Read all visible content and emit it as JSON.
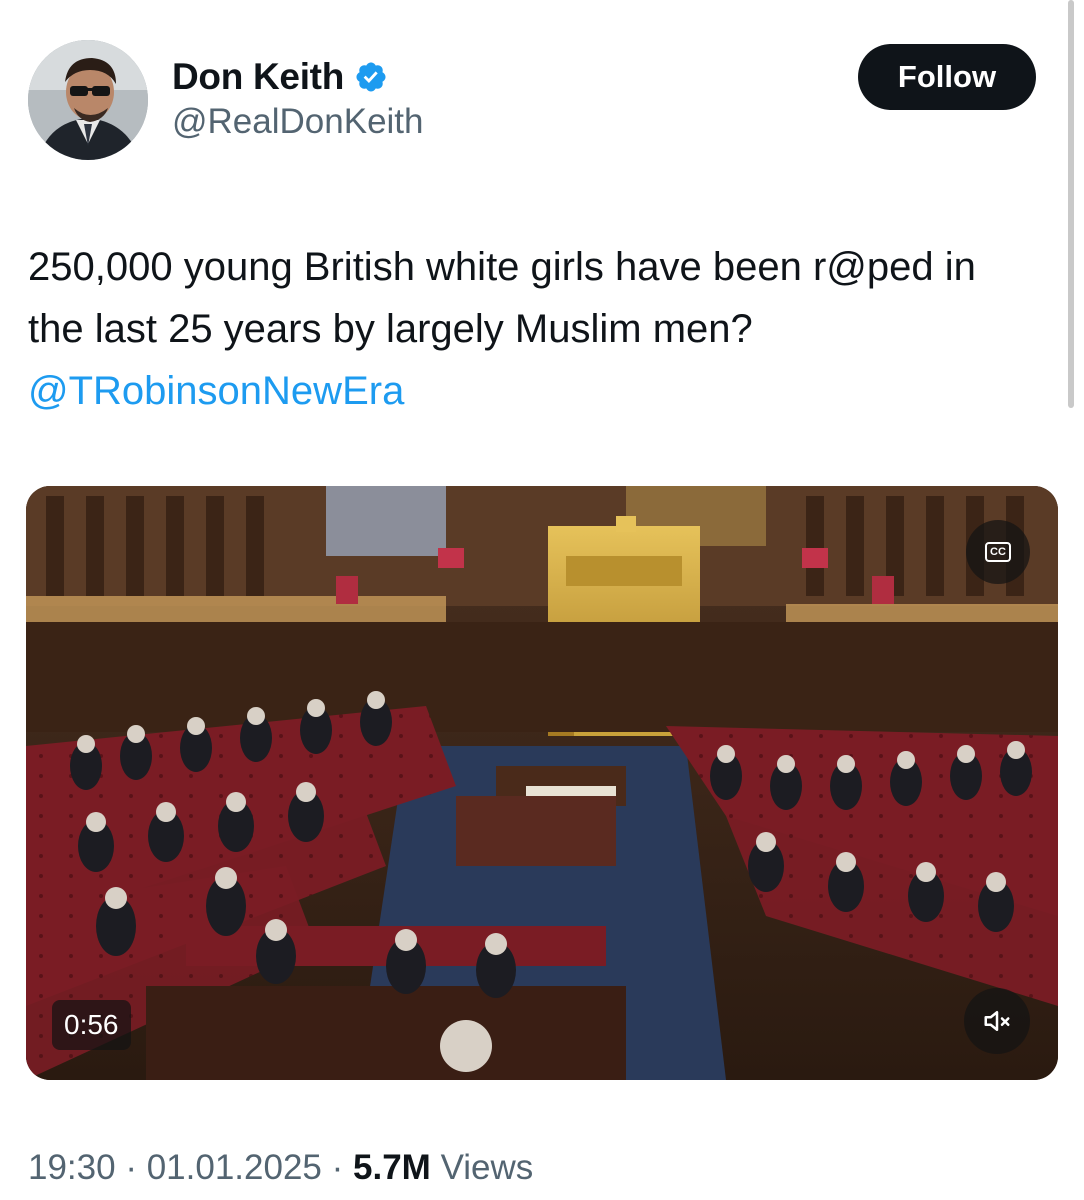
{
  "author": {
    "display_name": "Don Keith",
    "handle": "@RealDonKeith",
    "avatar_icon": "profile-photo"
  },
  "follow_label": "Follow",
  "tweet": {
    "text": "250,000 young British white girls have been r@ped in the last 25 years by largely Muslim men?",
    "mention": "@TRobinsonNewEra"
  },
  "media": {
    "duration": "0:56",
    "captions_icon": "cc-icon",
    "caption_icon_text": "CC",
    "mute_icon": "speaker-muted-icon"
  },
  "meta": {
    "time": "19:30",
    "separator": "·",
    "date": "01.01.2025",
    "views_count": "5.7M",
    "views_label": "Views"
  },
  "colors": {
    "text": "#0f1419",
    "secondary": "#536471",
    "link": "#1d9bf0",
    "verified": "#1d9bf0",
    "follow_bg": "#0f1419"
  }
}
